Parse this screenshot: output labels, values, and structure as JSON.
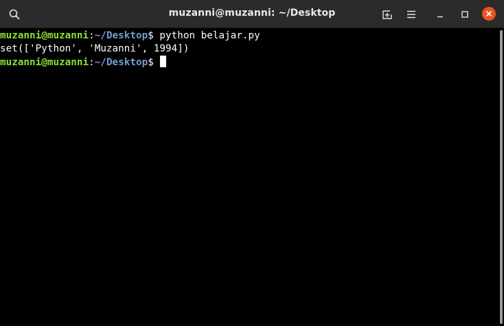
{
  "window": {
    "title": "muzanni@muzanni: ~/Desktop"
  },
  "titlebar": {
    "icons": [
      "search-icon",
      "new-tab-icon",
      "menu-icon",
      "minimize-icon",
      "maximize-icon",
      "close-icon"
    ]
  },
  "terminal": {
    "lines": [
      {
        "user_host": "muzanni@muzanni",
        "separator": ":",
        "path": "~/Desktop",
        "prompt": "$ ",
        "command": "python belajar.py"
      },
      {
        "output": "set(['Python', 'Muzanni', 1994])"
      },
      {
        "user_host": "muzanni@muzanni",
        "separator": ":",
        "path": "~/Desktop",
        "prompt": "$ ",
        "command": ""
      }
    ]
  },
  "colors": {
    "user_host": "#8ae234",
    "path": "#729fcf",
    "close_button": "#e95420",
    "titlebar": "#2b2b2b"
  }
}
